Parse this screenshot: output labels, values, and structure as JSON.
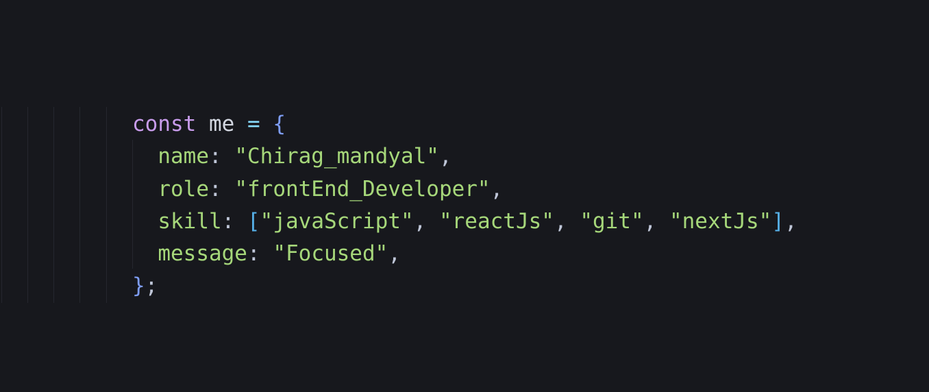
{
  "code": {
    "line1": {
      "keyword": "const",
      "identifier": "me",
      "operator": "=",
      "brace": "{"
    },
    "line2": {
      "indent": "  ",
      "key": "name",
      "colon": ":",
      "value": "\"Chirag_mandyal\"",
      "comma": ","
    },
    "line3": {
      "indent": "  ",
      "key": "role",
      "colon": ":",
      "value": "\"frontEnd_Developer\"",
      "comma": ","
    },
    "line4": {
      "indent": "  ",
      "key": "skill",
      "colon": ":",
      "open_bracket": "[",
      "items": [
        "\"javaScript\"",
        "\"reactJs\"",
        "\"git\"",
        "\"nextJs\""
      ],
      "separator": ",",
      "close_bracket": "]",
      "comma": ","
    },
    "line5": {
      "indent": "  ",
      "key": "message",
      "colon": ":",
      "value": "\"Focused\"",
      "comma": ","
    },
    "line6": {
      "brace": "}",
      "semicolon": ";"
    }
  },
  "colors": {
    "background": "#17181d",
    "keyword": "#c79bea",
    "identifier": "#d2d6e0",
    "operator": "#89ddff",
    "brace": "#7e9df5",
    "bracket": "#56b0e8",
    "property": "#a6d77a",
    "string": "#a6d77a",
    "punctuation": "#bfc6d8",
    "indent_guide": "#25272f"
  }
}
